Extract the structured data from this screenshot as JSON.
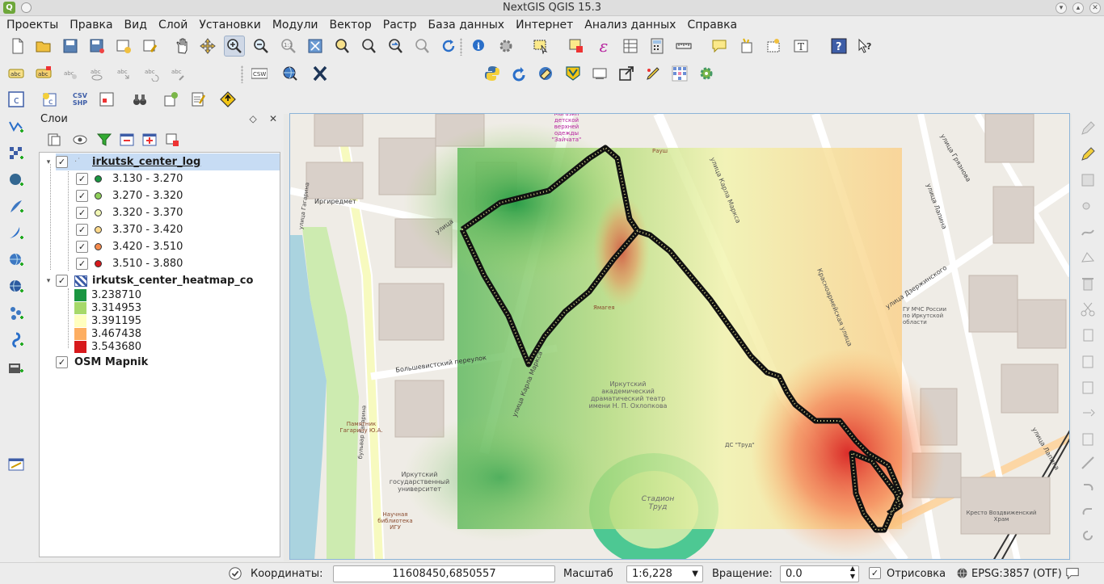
{
  "window": {
    "title": "NextGIS QGIS 15.3"
  },
  "menu": [
    "Проекты",
    "Правка",
    "Вид",
    "Слой",
    "Установки",
    "Модули",
    "Вектор",
    "Растр",
    "База данных",
    "Интернет",
    "Анализ данных",
    "Справка"
  ],
  "toolbar_labels": {
    "csw": "CSW",
    "csv_shp": "CSV\nSHP",
    "csv": "CSV",
    "shp": "SHP",
    "abc": "abc"
  },
  "layers_panel": {
    "title": "Слои",
    "layers": [
      {
        "name": "irkutsk_center_log",
        "checked": true,
        "selected": true,
        "classes": [
          {
            "label": "3.130 - 3.270",
            "color": "#1a9641"
          },
          {
            "label": "3.270 - 3.320",
            "color": "#8fd05a"
          },
          {
            "label": "3.320 - 3.370",
            "color": "#f2f7b5"
          },
          {
            "label": "3.370 - 3.420",
            "color": "#fdd98b"
          },
          {
            "label": "3.420 - 3.510",
            "color": "#f58a4c"
          },
          {
            "label": "3.510 - 3.880",
            "color": "#d7191c"
          }
        ]
      },
      {
        "name": "irkutsk_center_heatmap_co",
        "checked": true,
        "classes": [
          {
            "label": "3.238710",
            "color": "#1a9641"
          },
          {
            "label": "3.314953",
            "color": "#a6d96a"
          },
          {
            "label": "3.391195",
            "color": "#ffffbf"
          },
          {
            "label": "3.467438",
            "color": "#fdae61"
          },
          {
            "label": "3.543680",
            "color": "#d7191c"
          }
        ]
      },
      {
        "name": "OSM Mapnik",
        "checked": true
      }
    ]
  },
  "map_labels": {
    "street_gagarina": "улица Гагарина",
    "irgiredmet": "Иргиредмет",
    "bolsheviist": "Большевистский переулок",
    "karla_marksa": "улица Карла Маркса",
    "karla_marksa2": "улица Карла Маркса",
    "bulvar_gagarina": "бульвар Гагарина",
    "pamyatnik": "Памятник Гагарину Ю.А.",
    "university": "Иркутский государственный университет",
    "library": "Научная библиотека ИГУ",
    "theater": "Иркутский академический драматический театр имени Н. П. Охлопкова",
    "stadium": "Стадион Труд",
    "ds_trud": "ДС \"Труд\"",
    "krasnoarmeyskaya": "Красноармейская улица",
    "dzerzhinskogo": "улица Дзержинского",
    "lapina": "улица Лапина",
    "lapina2": "улица Лапина",
    "gryaznova": "улица Грязнова",
    "gu_mchs": "ГУ МЧС России по Иркутской области",
    "krestovozdvizh": "Кресто Воздвиженский Храм",
    "store": "Магазин детской верхней одежды \"Зайчата\"",
    "raush": "Рауш",
    "zvyagin": "Ямагея",
    "street_ul": "улица"
  },
  "statusbar": {
    "coords_label": "Координаты:",
    "coords_value": "11608450,6850557",
    "scale_label": "Масштаб",
    "scale_value": "1:6,228",
    "rotation_label": "Вращение:",
    "rotation_value": "0.0",
    "render_label": "Отрисовка",
    "render_checked": true,
    "crs_label": "EPSG:3857 (OTF)"
  }
}
